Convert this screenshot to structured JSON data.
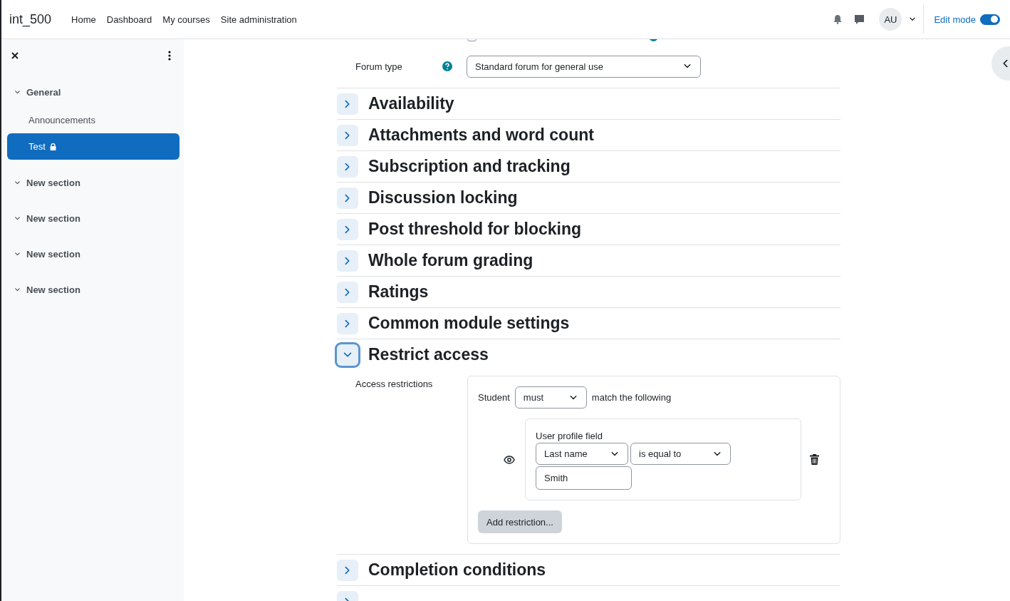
{
  "header": {
    "site_name": "int_500",
    "nav": [
      {
        "label": "Home"
      },
      {
        "label": "Dashboard"
      },
      {
        "label": "My courses"
      },
      {
        "label": "Site administration"
      }
    ],
    "avatar": "AU",
    "edit_mode": {
      "label": "Edit mode",
      "on": true
    }
  },
  "sidebar": {
    "items": [
      {
        "label": "General",
        "expanded": true,
        "children": [
          {
            "label": "Announcements",
            "selected": false,
            "locked": false
          },
          {
            "label": "Test",
            "selected": true,
            "locked": true
          }
        ]
      },
      {
        "label": "New section",
        "expanded": true
      },
      {
        "label": "New section",
        "expanded": true
      },
      {
        "label": "New section",
        "expanded": true
      },
      {
        "label": "New section",
        "expanded": true
      }
    ]
  },
  "form": {
    "display_description": {
      "checked": false
    },
    "forum_type": {
      "label": "Forum type",
      "value": "Standard forum for general use"
    },
    "sections": [
      {
        "title": "Availability",
        "expanded": false
      },
      {
        "title": "Attachments and word count",
        "expanded": false
      },
      {
        "title": "Subscription and tracking",
        "expanded": false
      },
      {
        "title": "Discussion locking",
        "expanded": false
      },
      {
        "title": "Post threshold for blocking",
        "expanded": false
      },
      {
        "title": "Whole forum grading",
        "expanded": false
      },
      {
        "title": "Ratings",
        "expanded": false
      },
      {
        "title": "Common module settings",
        "expanded": false
      },
      {
        "title": "Restrict access",
        "expanded": true
      },
      {
        "title": "Completion conditions",
        "expanded": false
      },
      {
        "expanded": false
      }
    ],
    "restrict_access": {
      "label": "Access restrictions",
      "prefix": "Student",
      "match": "must",
      "suffix": "match the following",
      "condition": {
        "title": "User profile field",
        "field": "Last name",
        "operator": "is equal to",
        "value": "Smith"
      },
      "add_button": "Add restriction..."
    }
  }
}
